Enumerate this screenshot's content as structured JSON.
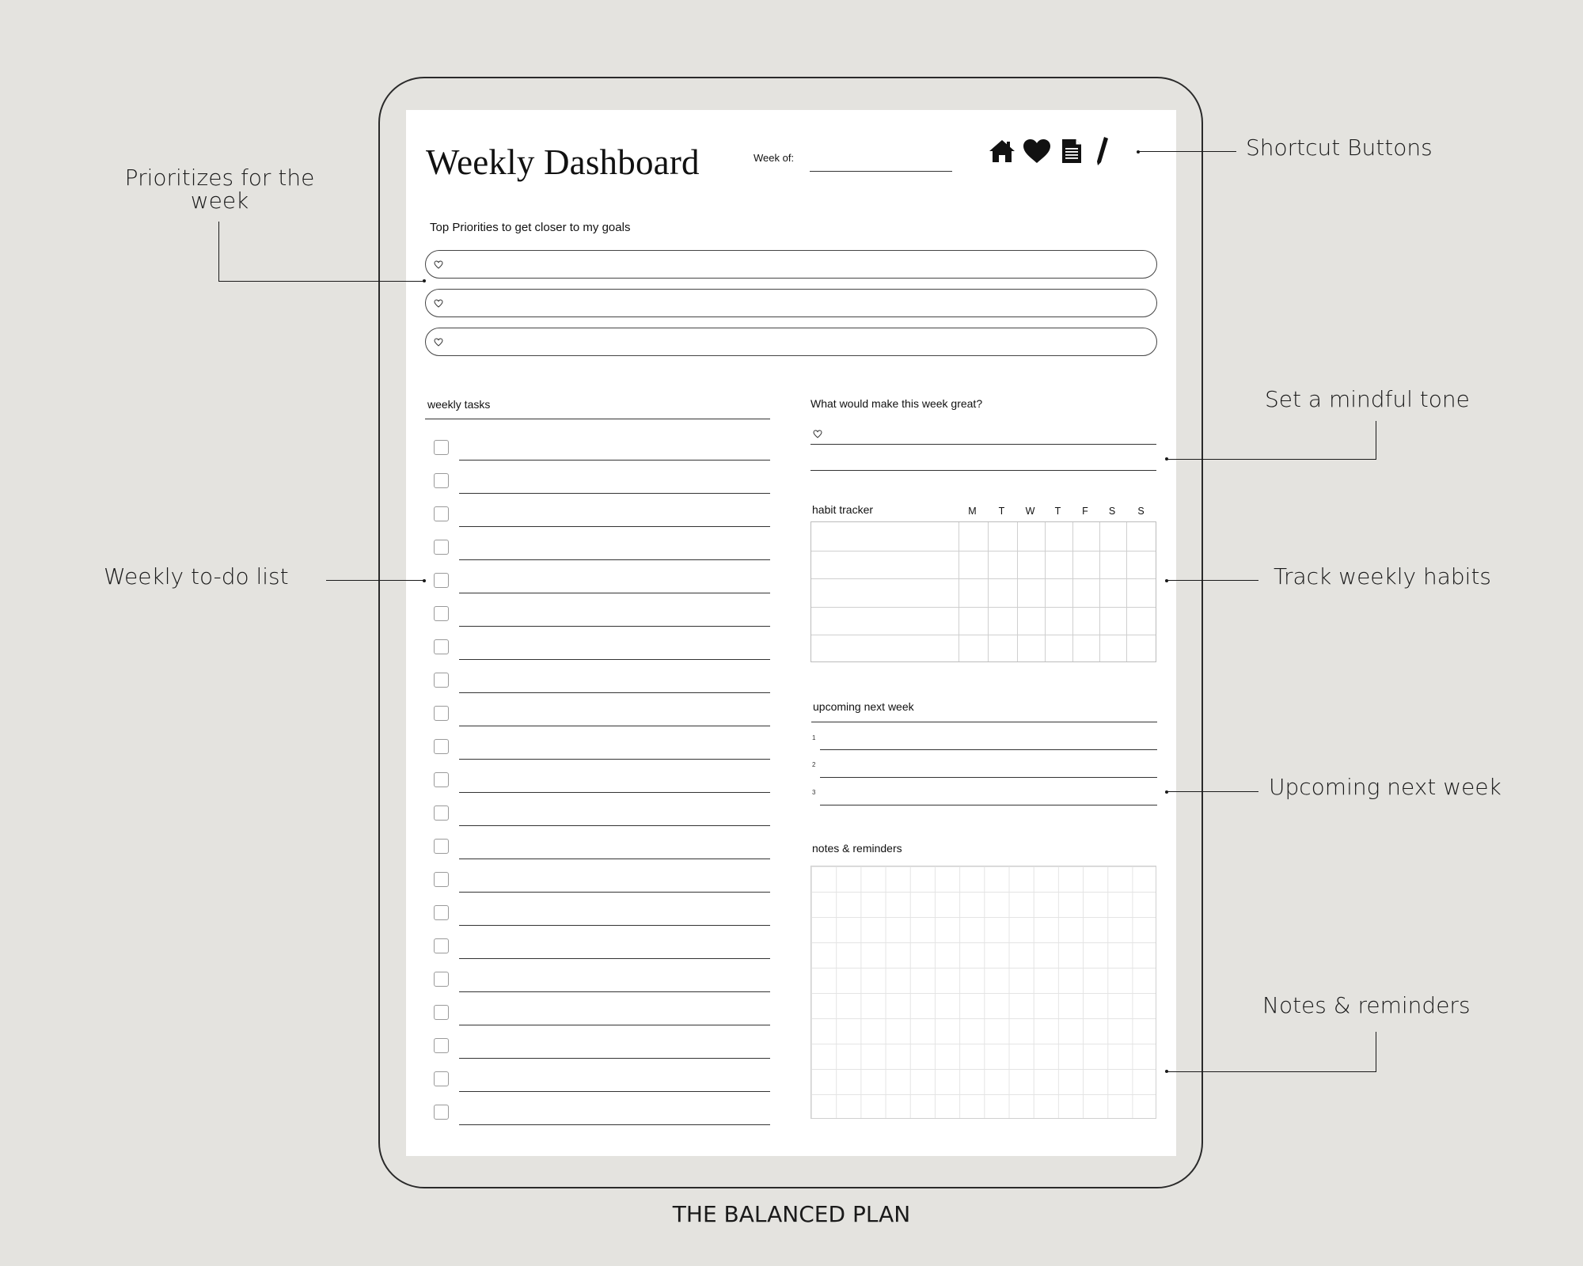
{
  "page": {
    "title": "Weekly Dashboard",
    "week_of_label": "Week of:",
    "shortcuts": [
      {
        "name": "home-icon"
      },
      {
        "name": "heart-icon"
      },
      {
        "name": "document-icon"
      },
      {
        "name": "pen-icon"
      }
    ],
    "priorities_label": "Top Priorities to get closer to my goals",
    "weekly_tasks_label": "weekly tasks",
    "task_count": 21,
    "great_week_label": "What would make this week great?",
    "habit_tracker": {
      "label": "habit tracker",
      "days": [
        "M",
        "T",
        "W",
        "T",
        "F",
        "S",
        "S"
      ]
    },
    "upcoming_label": "upcoming next week",
    "upcoming_numbers": [
      "1",
      "2",
      "3"
    ],
    "notes_label": "notes & reminders"
  },
  "callouts": {
    "priorities": "Prioritizes for the week",
    "todo": "Weekly to-do list",
    "shortcuts": "Shortcut Buttons",
    "mindful": "Set a mindful tone",
    "habits": "Track weekly habits",
    "upcoming": "Upcoming next week",
    "notes": "Notes & reminders"
  },
  "footer": "THE BALANCED PLAN",
  "colors": {
    "background": "#e4e3df",
    "paper": "#ffffff",
    "ink": "#111111"
  }
}
